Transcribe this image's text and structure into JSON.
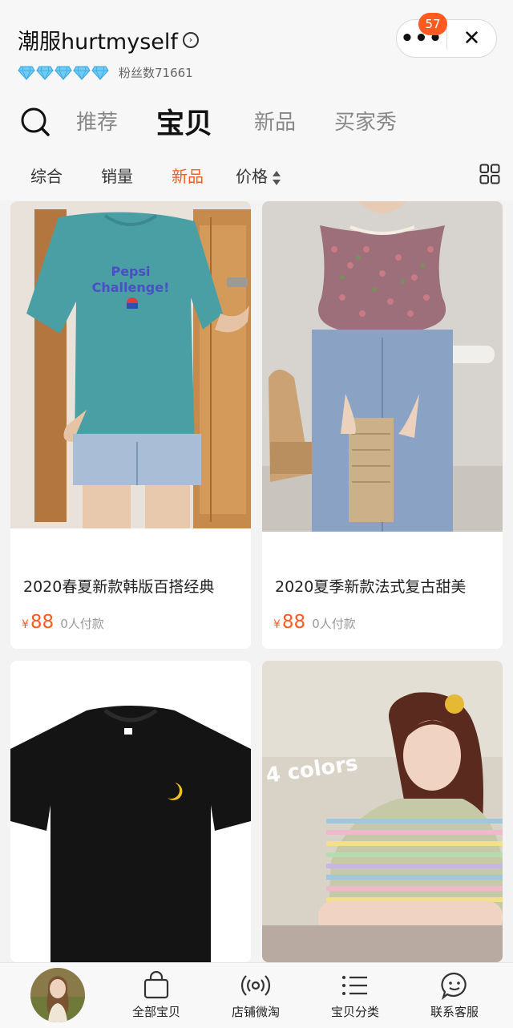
{
  "store": {
    "name": "潮服hurtmyself",
    "arrow_icon": "chevron-right-circle-icon",
    "diamond_count": 5,
    "fans_label": "粉丝数71661"
  },
  "capsule": {
    "more_icon": "more-dots-icon",
    "close_icon": "close-icon",
    "badge_count": "57"
  },
  "tabs": [
    {
      "label": "推荐",
      "active": false
    },
    {
      "label": "宝贝",
      "active": true
    },
    {
      "label": "新品",
      "active": false
    },
    {
      "label": "买家秀",
      "active": false
    }
  ],
  "sort": [
    {
      "label": "综合",
      "active": false
    },
    {
      "label": "销量",
      "active": false
    },
    {
      "label": "新品",
      "active": true
    },
    {
      "label": "价格",
      "active": false
    }
  ],
  "products": [
    {
      "title": "2020春夏新款韩版百搭经典",
      "price_symbol": "¥",
      "price": "88",
      "sold": "0人付款"
    },
    {
      "title": "2020夏季新款法式复古甜美",
      "price_symbol": "¥",
      "price": "88",
      "sold": "0人付款"
    },
    {
      "title": "",
      "price_symbol": "",
      "price": "",
      "sold": ""
    },
    {
      "title": "",
      "price_symbol": "",
      "price": "",
      "sold": "",
      "image_text": "4 colors"
    }
  ],
  "bottom_nav": [
    {
      "label": "全部宝贝",
      "icon": "shopping-bag-icon"
    },
    {
      "label": "店铺微淘",
      "icon": "broadcast-icon"
    },
    {
      "label": "宝贝分类",
      "icon": "list-icon"
    },
    {
      "label": "联系客服",
      "icon": "chat-face-icon"
    }
  ],
  "colors": {
    "accent": "#ff5a1f",
    "diamond": "#5bc0f0"
  }
}
